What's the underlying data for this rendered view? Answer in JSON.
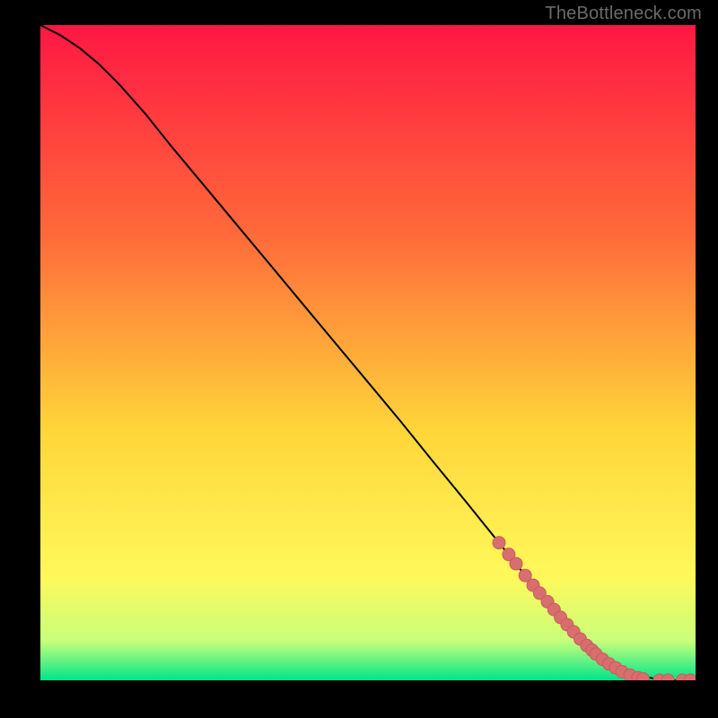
{
  "watermark": "TheBottleneck.com",
  "colors": {
    "bg": "#000000",
    "watermark": "#6a6a6a",
    "curve": "#000000",
    "points_fill": "#d86e6e",
    "points_stroke": "#c85c5c",
    "grad_top": "#ff1744",
    "grad_mid1": "#ff6a3a",
    "grad_mid2": "#ffd63a",
    "grad_mid3": "#fff85a",
    "grad_band": "#c8ff7a",
    "grad_bottom": "#00e58a"
  },
  "chart_data": {
    "type": "line",
    "title": "",
    "xlabel": "",
    "ylabel": "",
    "xlim": [
      0,
      1
    ],
    "ylim": [
      0,
      1
    ],
    "curve": {
      "comment": "normalized x,y of the black curve; y=1 is top, y=0 is bottom",
      "x": [
        0.0,
        0.03,
        0.06,
        0.09,
        0.12,
        0.16,
        0.2,
        0.25,
        0.3,
        0.35,
        0.4,
        0.45,
        0.5,
        0.55,
        0.6,
        0.65,
        0.7,
        0.74,
        0.78,
        0.82,
        0.85,
        0.88,
        0.91,
        0.94,
        0.97,
        1.0
      ],
      "y": [
        1.0,
        0.985,
        0.965,
        0.94,
        0.91,
        0.865,
        0.815,
        0.755,
        0.695,
        0.635,
        0.575,
        0.515,
        0.455,
        0.395,
        0.333,
        0.272,
        0.21,
        0.16,
        0.113,
        0.07,
        0.042,
        0.02,
        0.008,
        0.002,
        0.0,
        0.0
      ]
    },
    "series": [
      {
        "name": "points",
        "comment": "pink/red sample dots, normalized x,y",
        "x": [
          0.7,
          0.715,
          0.726,
          0.74,
          0.752,
          0.762,
          0.774,
          0.784,
          0.794,
          0.804,
          0.814,
          0.824,
          0.834,
          0.842,
          0.848,
          0.858,
          0.868,
          0.878,
          0.888,
          0.9,
          0.912,
          0.92,
          0.945,
          0.958,
          0.98,
          0.992
        ],
        "y": [
          0.21,
          0.192,
          0.178,
          0.16,
          0.145,
          0.133,
          0.12,
          0.108,
          0.096,
          0.085,
          0.074,
          0.063,
          0.053,
          0.046,
          0.04,
          0.032,
          0.025,
          0.019,
          0.013,
          0.008,
          0.004,
          0.002,
          0.0,
          0.0,
          0.0,
          0.0
        ]
      }
    ]
  }
}
